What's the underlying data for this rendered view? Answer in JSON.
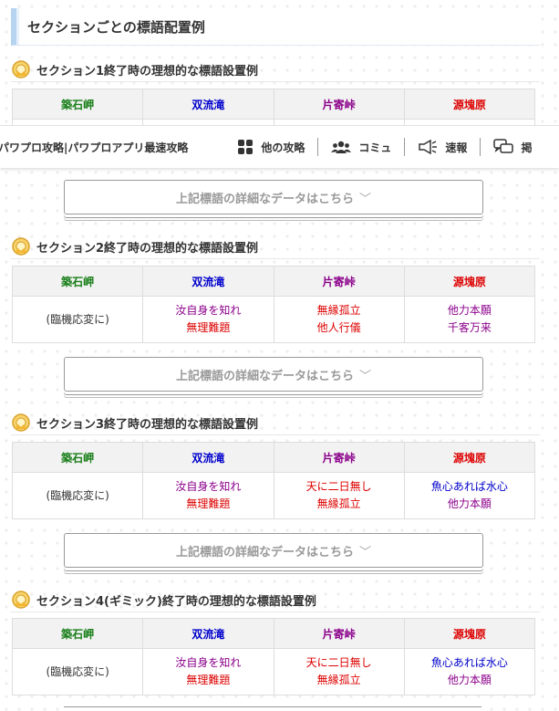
{
  "main_heading": "セクションごとの標語配置例",
  "columns": [
    {
      "label": "築石岬",
      "color": "#1a7f1a"
    },
    {
      "label": "双流滝",
      "color": "#0000cc"
    },
    {
      "label": "片寄峠",
      "color": "#8b008b"
    },
    {
      "label": "源塊原",
      "color": "#dd0000"
    }
  ],
  "sections": [
    {
      "title": "セクション1終了時の理想的な標語設置例",
      "button": "上記標語の詳細なデータはこちら"
    },
    {
      "title": "セクション2終了時の理想的な標語設置例",
      "cells": [
        {
          "lines": [
            {
              "text": "(臨機応変に)",
              "color": "#333333"
            }
          ]
        },
        {
          "lines": [
            {
              "text": "汝自身を知れ",
              "color": "#8b008b"
            },
            {
              "text": "無理難題",
              "color": "#dd0000"
            }
          ]
        },
        {
          "lines": [
            {
              "text": "無縁孤立",
              "color": "#dd0000"
            },
            {
              "text": "他人行儀",
              "color": "#dd0000"
            }
          ]
        },
        {
          "lines": [
            {
              "text": "他力本願",
              "color": "#8b008b"
            },
            {
              "text": "千客万来",
              "color": "#8b008b"
            }
          ]
        }
      ],
      "button": "上記標語の詳細なデータはこちら"
    },
    {
      "title": "セクション3終了時の理想的な標語設置例",
      "cells": [
        {
          "lines": [
            {
              "text": "(臨機応変に)",
              "color": "#333333"
            }
          ]
        },
        {
          "lines": [
            {
              "text": "汝自身を知れ",
              "color": "#8b008b"
            },
            {
              "text": "無理難題",
              "color": "#dd0000"
            }
          ]
        },
        {
          "lines": [
            {
              "text": "天に二日無し",
              "color": "#dd0000"
            },
            {
              "text": "無縁孤立",
              "color": "#dd0000"
            }
          ]
        },
        {
          "lines": [
            {
              "text": "魚心あれば水心",
              "color": "#0000cc"
            },
            {
              "text": "他力本願",
              "color": "#8b008b"
            }
          ]
        }
      ],
      "button": "上記標語の詳細なデータはこちら"
    },
    {
      "title": "セクション4(ギミック)終了時の理想的な標語設置例",
      "cells": [
        {
          "lines": [
            {
              "text": "(臨機応変に)",
              "color": "#333333"
            }
          ]
        },
        {
          "lines": [
            {
              "text": "汝自身を知れ",
              "color": "#8b008b"
            },
            {
              "text": "無理難題",
              "color": "#dd0000"
            }
          ]
        },
        {
          "lines": [
            {
              "text": "天に二日無し",
              "color": "#dd0000"
            },
            {
              "text": "無縁孤立",
              "color": "#dd0000"
            }
          ]
        },
        {
          "lines": [
            {
              "text": "魚心あれば水心",
              "color": "#0000cc"
            },
            {
              "text": "他力本願",
              "color": "#8b008b"
            }
          ]
        }
      ]
    }
  ],
  "sticky_header": {
    "brand": "パワプロ攻略|パワプロアプリ最速攻略",
    "nav": [
      {
        "label": "他の攻略",
        "icon": "grid-icon"
      },
      {
        "label": "コミュ",
        "icon": "users-icon"
      },
      {
        "label": "速報",
        "icon": "megaphone-icon"
      },
      {
        "label": "掲",
        "icon": "chat-icon"
      }
    ]
  },
  "colors": {
    "accent_border": "#b6d4ef",
    "table_header_bg": "#f2f2f2"
  }
}
